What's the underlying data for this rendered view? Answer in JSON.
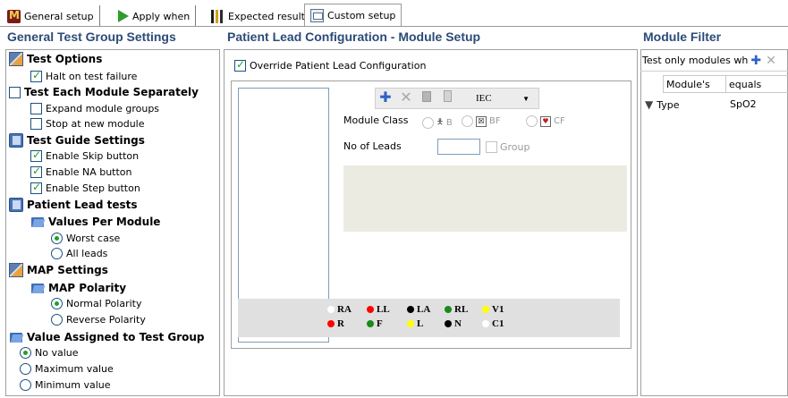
{
  "tabs": [
    {
      "label": "General setup",
      "icon": "modules-icon"
    },
    {
      "label": "Apply when",
      "icon": "play-icon"
    },
    {
      "label": "Expected results",
      "icon": "chart-icon"
    },
    {
      "label": "Custom setup",
      "icon": "custom-setup-icon"
    }
  ],
  "sections": {
    "left_title": "General Test Group Settings",
    "middle_title": "Patient Lead Configuration - Module Setup",
    "right_title": "Module Filter"
  },
  "tree": {
    "test_options": "Test Options",
    "halt": "Halt on test failure",
    "test_each": "Test Each Module Separately",
    "expand": "Expand module groups",
    "stop_new": "Stop at new module",
    "guide": "Test Guide Settings",
    "skip": "Enable Skip button",
    "na": "Enable NA button",
    "step": "Enable Step button",
    "patient_lead": "Patient Lead tests",
    "values_per_module": "Values Per Module",
    "worst": "Worst case",
    "all_leads": "All leads",
    "map_settings": "MAP Settings",
    "map_polarity": "MAP Polarity",
    "normal": "Normal Polarity",
    "reverse": "Reverse Polarity",
    "value_assigned": "Value Assigned to Test Group",
    "no_value": "No value",
    "max": "Maximum value",
    "min": "Minimum value"
  },
  "middle": {
    "override": "Override Patient Lead Configuration",
    "standard": "IEC",
    "module_class": "Module Class",
    "class_b": "B",
    "class_bf": "BF",
    "class_cf": "CF",
    "no_of_leads": "No of Leads",
    "group": "Group",
    "leads": [
      {
        "name": "RA",
        "color": "#ffffff"
      },
      {
        "name": "LL",
        "color": "#ff0000"
      },
      {
        "name": "LA",
        "color": "#000000"
      },
      {
        "name": "RL",
        "color": "#1a8a1a"
      },
      {
        "name": "V1",
        "color": "#ffff00"
      },
      {
        "name": "R",
        "color": "#ff0000"
      },
      {
        "name": "F",
        "color": "#1a8a1a"
      },
      {
        "name": "L",
        "color": "#ffff00"
      },
      {
        "name": "N",
        "color": "#000000"
      },
      {
        "name": "C1",
        "color": "#ffffff"
      }
    ]
  },
  "filter": {
    "header": "Test only modules wh",
    "col1": "Module's",
    "col2": "equals",
    "row_field": "Type",
    "row_value": "SpO2"
  }
}
